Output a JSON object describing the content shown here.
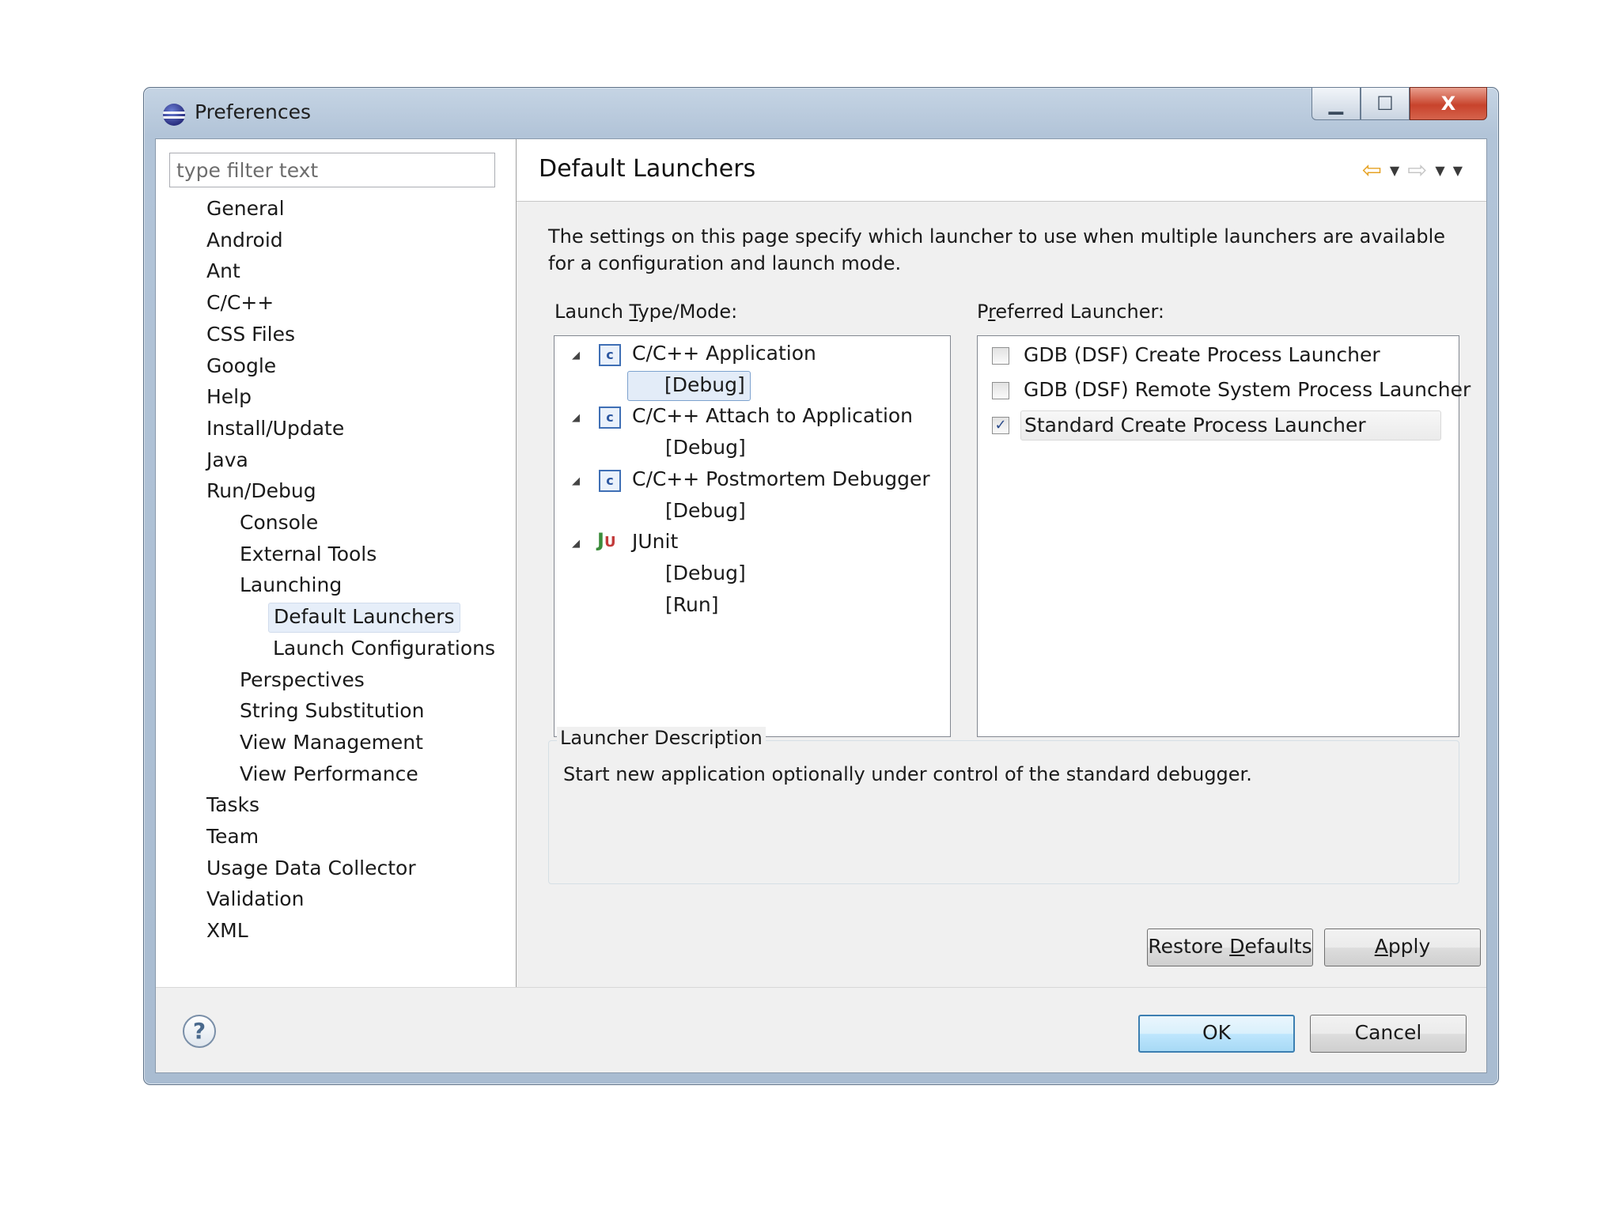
{
  "window": {
    "title": "Preferences",
    "controls": {
      "minimize": "▁",
      "maximize": "☐",
      "close": "X"
    }
  },
  "filter": {
    "placeholder": "type filter text"
  },
  "tree": [
    {
      "label": "General"
    },
    {
      "label": "Android"
    },
    {
      "label": "Ant"
    },
    {
      "label": "C/C++"
    },
    {
      "label": "CSS Files"
    },
    {
      "label": "Google"
    },
    {
      "label": "Help"
    },
    {
      "label": "Install/Update"
    },
    {
      "label": "Java"
    },
    {
      "label": "Run/Debug"
    },
    {
      "label": "Console"
    },
    {
      "label": "External Tools"
    },
    {
      "label": "Launching"
    },
    {
      "label": "Default Launchers",
      "selected": true
    },
    {
      "label": "Launch Configurations"
    },
    {
      "label": "Perspectives"
    },
    {
      "label": "String Substitution"
    },
    {
      "label": "View Management"
    },
    {
      "label": "View Performance"
    },
    {
      "label": "Tasks"
    },
    {
      "label": "Team"
    },
    {
      "label": "Usage Data Collector"
    },
    {
      "label": "Validation"
    },
    {
      "label": "XML"
    }
  ],
  "page": {
    "title": "Default Launchers",
    "nav": {
      "back_icon": "⇦",
      "forward_icon": "⇨",
      "dropdown_icon": "▼"
    },
    "description": "The settings on this page specify which launcher to use when multiple launchers are available for a configuration and launch mode.",
    "launch_type_label": {
      "before": "Launch ",
      "mnemonic": "T",
      "after": "ype/Mode:"
    },
    "preferred_label": {
      "before": "P",
      "mnemonic": "r",
      "after": "eferred Launcher:"
    },
    "launch_types": [
      {
        "label": "C/C++ Application",
        "icon": "c-launch-icon",
        "icon_text": "c",
        "modes": [
          {
            "label": "[Debug]",
            "selected": true
          }
        ]
      },
      {
        "label": "C/C++ Attach to Application",
        "icon": "c-launch-icon",
        "icon_text": "c",
        "modes": [
          {
            "label": "[Debug]"
          }
        ]
      },
      {
        "label": "C/C++ Postmortem Debugger",
        "icon": "c-launch-icon",
        "icon_text": "c",
        "modes": [
          {
            "label": "[Debug]"
          }
        ]
      },
      {
        "label": "JUnit",
        "icon": "junit-icon",
        "icon_text": "Ju",
        "modes": [
          {
            "label": "[Debug]"
          },
          {
            "label": "[Run]"
          }
        ]
      }
    ],
    "launchers": [
      {
        "label": "GDB (DSF) Create Process Launcher",
        "checked": false
      },
      {
        "label": "GDB (DSF) Remote System Process Launcher",
        "checked": false
      },
      {
        "label": "Standard Create Process Launcher",
        "checked": true
      }
    ],
    "launcher_description": {
      "legend": "Launcher Description",
      "text": "Start new application optionally under control of the standard debugger."
    },
    "buttons": {
      "restore_defaults": {
        "before": "Restore ",
        "mnemonic": "D",
        "after": "efaults"
      },
      "apply": {
        "before": "",
        "mnemonic": "A",
        "after": "pply"
      }
    }
  },
  "footer": {
    "help_icon": "?",
    "ok": "OK",
    "cancel": "Cancel"
  }
}
